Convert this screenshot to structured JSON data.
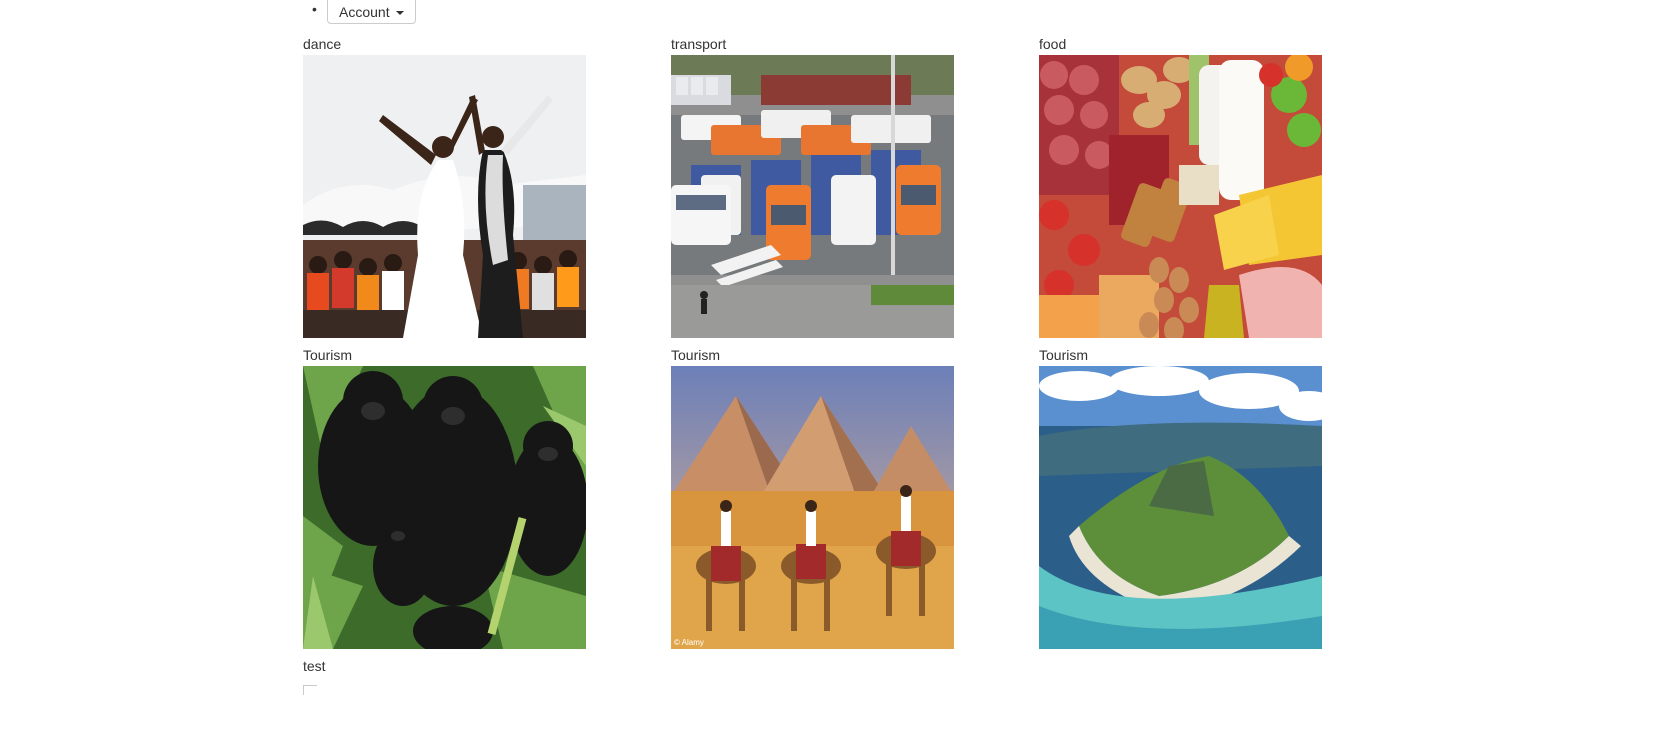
{
  "nav": {
    "bullet": "•",
    "account_label": "Account"
  },
  "gallery": [
    {
      "label": "dance",
      "image": "dance-performance-photo"
    },
    {
      "label": "transport",
      "image": "bus-station-photo"
    },
    {
      "label": "food",
      "image": "food-assortment-photo"
    },
    {
      "label": "Tourism",
      "image": "gorillas-photo"
    },
    {
      "label": "Tourism",
      "image": "pyramids-camels-photo"
    },
    {
      "label": "Tourism",
      "image": "island-aerial-photo"
    }
  ],
  "trailing": {
    "label": "test",
    "image": "broken-image-icon"
  },
  "watermark": "© Alamy"
}
